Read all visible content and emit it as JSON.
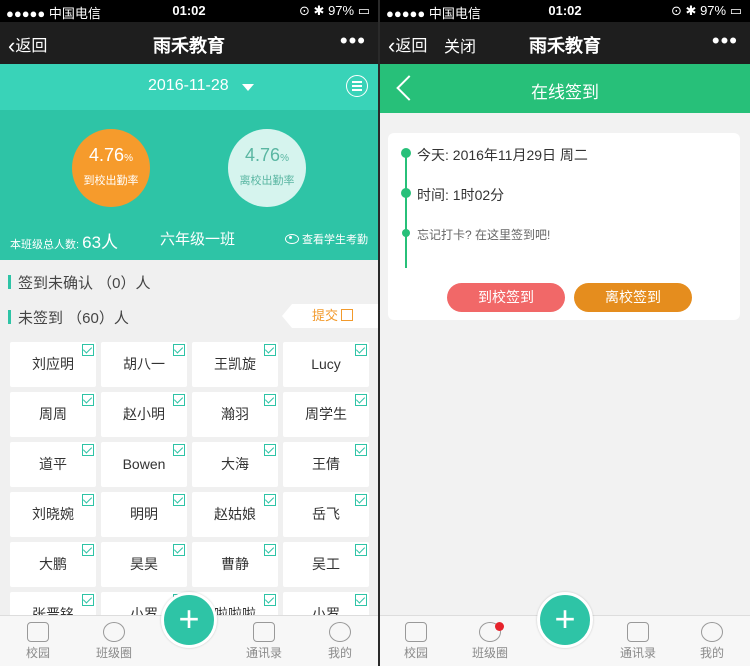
{
  "left": {
    "status": {
      "carrier": "●●●●● 中国电信",
      "time": "01:02",
      "battery": "97%"
    },
    "nav": {
      "back_label": "返回",
      "title": "雨禾教育",
      "more": "•••"
    },
    "date_bar": {
      "date": "2016-11-28"
    },
    "stats": [
      {
        "value": "4.76",
        "unit": "%",
        "label": "到校出勤率",
        "color": "#f69b2c"
      },
      {
        "value": "4.76",
        "unit": "%",
        "label": "离校出勤率",
        "color": "#d6f4ee"
      }
    ],
    "class_info": {
      "total_label": "本班级总人数:",
      "total_value": "63人",
      "class_name": "六年级一班",
      "view_label": "查看学生考勤"
    },
    "sections": {
      "unconfirmed": "签到未确认 （0）人",
      "not_signed": "未签到 （60）人",
      "submit_label": "提交"
    },
    "students": [
      "刘应明",
      "胡八一",
      "王凯旋",
      "Lucy",
      "周周",
      "赵小明",
      "瀚羽",
      "周学生",
      "道平",
      "Bowen",
      "大海",
      "王倩",
      "刘晓婉",
      "明明",
      "赵姑娘",
      "岳飞",
      "大鹏",
      "昊昊",
      "曹静",
      "吴工",
      "张晋铭",
      "小罗",
      "啦啦啦",
      "小罗"
    ],
    "tabs": {
      "campus": "校园",
      "class_circle": "班级圈",
      "contacts": "通讯录",
      "mine": "我的",
      "plus": "+"
    }
  },
  "right": {
    "status": {
      "carrier": "●●●●● 中国电信",
      "time": "01:02",
      "battery": "97%"
    },
    "nav": {
      "back_label": "返回",
      "close_label": "关闭",
      "title": "雨禾教育",
      "more": "•••"
    },
    "page_title": "在线签到",
    "today": "今天: 2016年11月29日 周二",
    "duration": "时间: 1时02分",
    "hint": "忘记打卡? 在这里签到吧!",
    "buttons": {
      "arrive": "到校签到",
      "leave": "离校签到"
    },
    "tabs": {
      "campus": "校园",
      "class_circle": "班级圈",
      "contacts": "通讯录",
      "mine": "我的",
      "plus": "+"
    },
    "accent_color": "#27c079"
  }
}
